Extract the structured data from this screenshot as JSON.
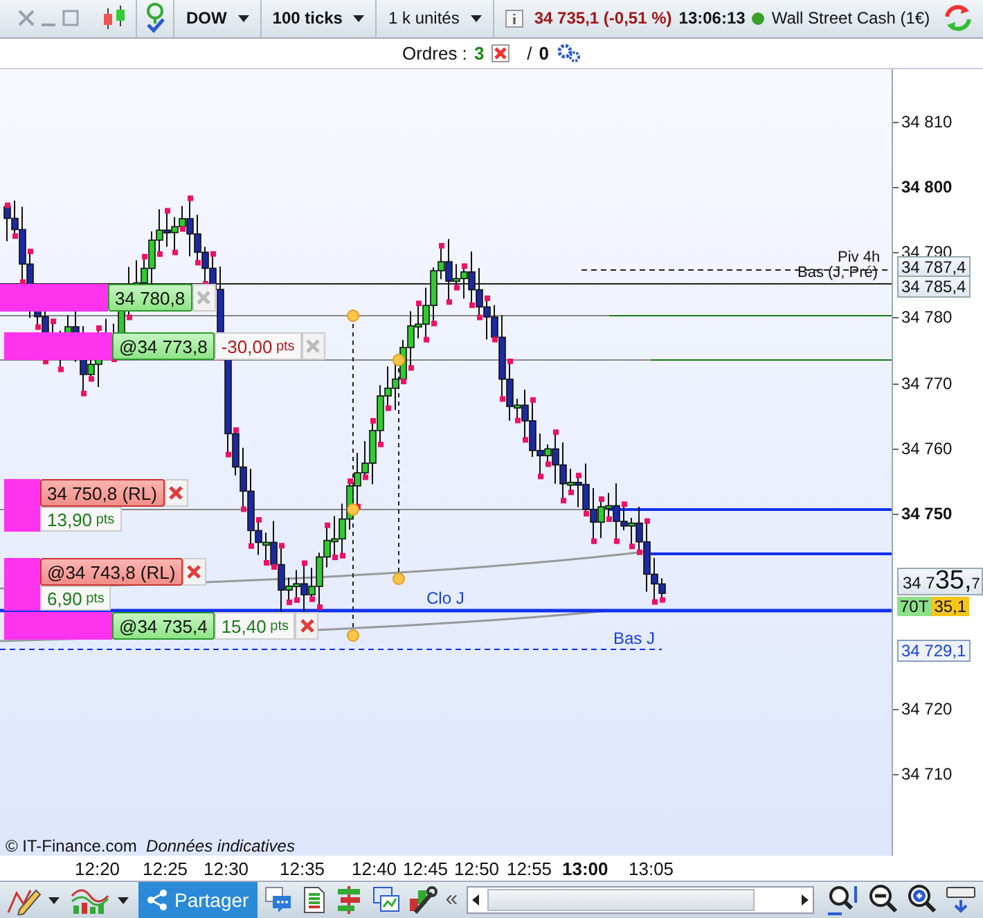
{
  "toolbar": {
    "symbol": "DOW",
    "interval": "100 ticks",
    "size": "1 k unités",
    "quote": "34 735,1 (-0,51 %)",
    "time": "13:06:13",
    "market_open": true,
    "instrument": "Wall Street Cash (1€)"
  },
  "orders_bar": {
    "label": "Ordres :",
    "count": "3",
    "separator": "/",
    "other_count": "0"
  },
  "chart": {
    "level_labels": [
      {
        "text": "Piv 4h",
        "kind": "pivot"
      },
      {
        "text": "Bas (J, Pré)",
        "kind": "pivot"
      },
      {
        "text": "Clo J",
        "kind": "day"
      },
      {
        "text": "Bas J",
        "kind": "day"
      }
    ],
    "orders": [
      {
        "kind": "entry",
        "price": "34 780,8",
        "cancel_active": false
      },
      {
        "kind": "entry",
        "price": "@34 773,8",
        "pnl": "-30,00",
        "unit": "pts",
        "pnl_loss": true,
        "cancel_active": false
      },
      {
        "kind": "exit",
        "price": "34 750,8 (RL)",
        "pnl": "13,90",
        "unit": "pts",
        "pnl_loss": false,
        "cancel_active": true
      },
      {
        "kind": "exit",
        "price": "@34 743,8 (RL)",
        "pnl": "6,90",
        "unit": "pts",
        "pnl_loss": false,
        "cancel_active": true
      },
      {
        "kind": "entry",
        "price": "@34 735,4",
        "pnl": "15,40",
        "unit": "pts",
        "pnl_loss": false,
        "cancel_active": true
      }
    ],
    "credit": {
      "source": "© IT-Finance.com",
      "note": "Données indicatives"
    },
    "y_ticks": [
      {
        "label": "34 810",
        "bold": false
      },
      {
        "label": "34 800",
        "bold": true
      },
      {
        "label": "34 790",
        "bold": false
      },
      {
        "label": "34 780",
        "bold": false
      },
      {
        "label": "34 770",
        "bold": false
      },
      {
        "label": "34 760",
        "bold": false
      },
      {
        "label": "34 750",
        "bold": true
      },
      {
        "label": "34 720",
        "bold": false
      },
      {
        "label": "34 710",
        "bold": false
      }
    ],
    "price_tags": [
      {
        "kind": "level",
        "text": "34 787,4"
      },
      {
        "kind": "level",
        "text": "34 785,4"
      },
      {
        "kind": "last",
        "head": "34 7",
        "big": "35,",
        "tail": "7"
      },
      {
        "kind": "bid",
        "volume": "70T",
        "text": "35,1"
      },
      {
        "kind": "low",
        "text": "34 729,1"
      }
    ],
    "x_ticks": [
      {
        "label": "12:20",
        "bold": false
      },
      {
        "label": "12:25",
        "bold": false
      },
      {
        "label": "12:30",
        "bold": false
      },
      {
        "label": "12:35",
        "bold": false
      },
      {
        "label": "12:40",
        "bold": false
      },
      {
        "label": "12:45",
        "bold": false
      },
      {
        "label": "12:50",
        "bold": false
      },
      {
        "label": "12:55",
        "bold": false
      },
      {
        "label": "13:00",
        "bold": true
      },
      {
        "label": "13:05",
        "bold": false
      }
    ]
  },
  "bottom_toolbar": {
    "share_label": "Partager",
    "collapse_glyph": "«"
  }
}
